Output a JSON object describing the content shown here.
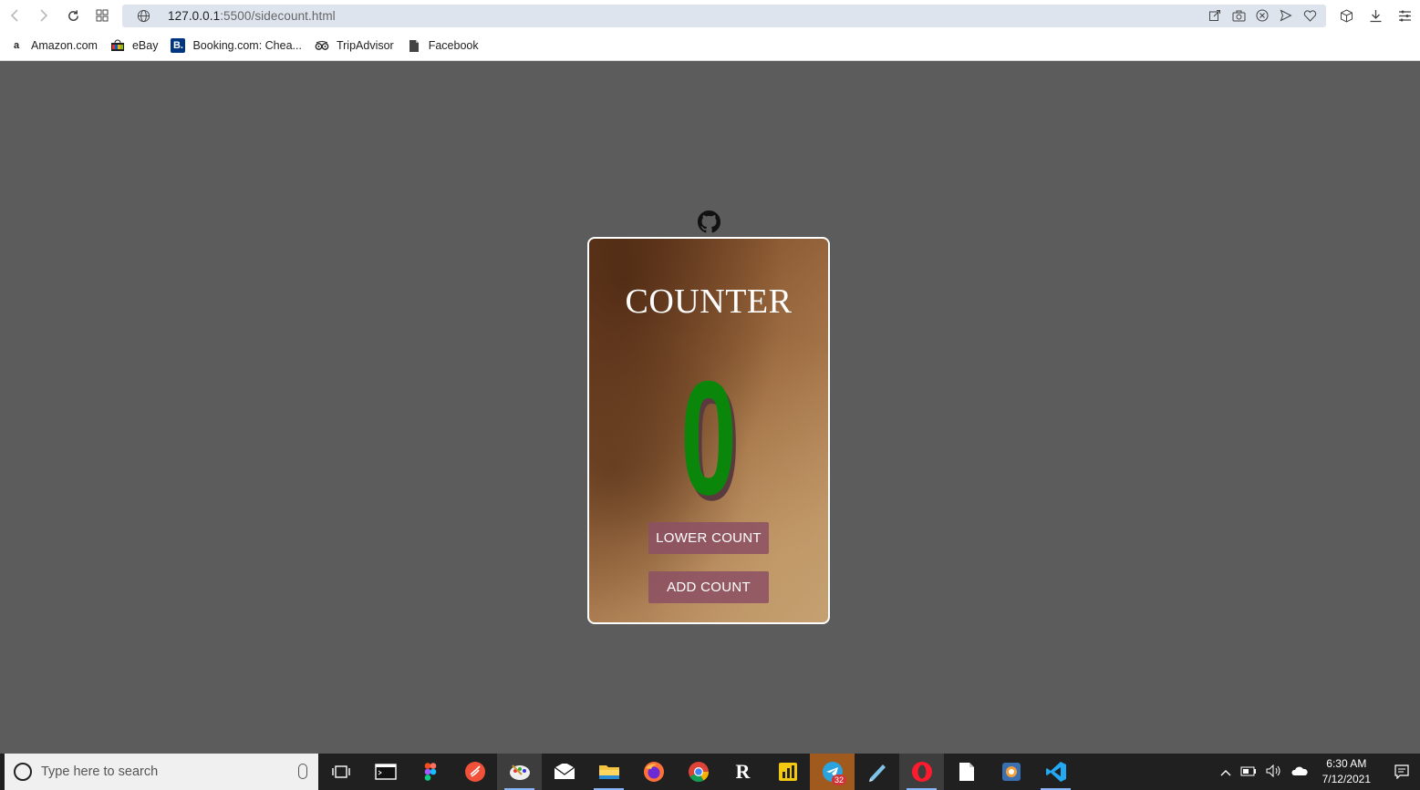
{
  "browser": {
    "url_host": "127.0.0.1",
    "url_rest": ":5500/sidecount.html"
  },
  "bookmarks": [
    {
      "label": "Amazon.com",
      "icon": "amazon-icon"
    },
    {
      "label": "eBay",
      "icon": "ebay-icon"
    },
    {
      "label": "Booking.com: Chea...",
      "icon": "booking-icon"
    },
    {
      "label": "TripAdvisor",
      "icon": "tripadvisor-icon"
    },
    {
      "label": "Facebook",
      "icon": "page-icon"
    }
  ],
  "counter": {
    "title": "COUNTER",
    "count": "0",
    "lower_label": "LOWER COUNT",
    "add_label": "ADD COUNT"
  },
  "taskbar": {
    "search_placeholder": "Type here to search",
    "telegram_badge": "32",
    "time": "6:30 AM",
    "date": "7/12/2021"
  },
  "colors": {
    "page_bg": "#5c5c5c",
    "count_color": "#0a870a",
    "button_bg": "#8c5064"
  }
}
